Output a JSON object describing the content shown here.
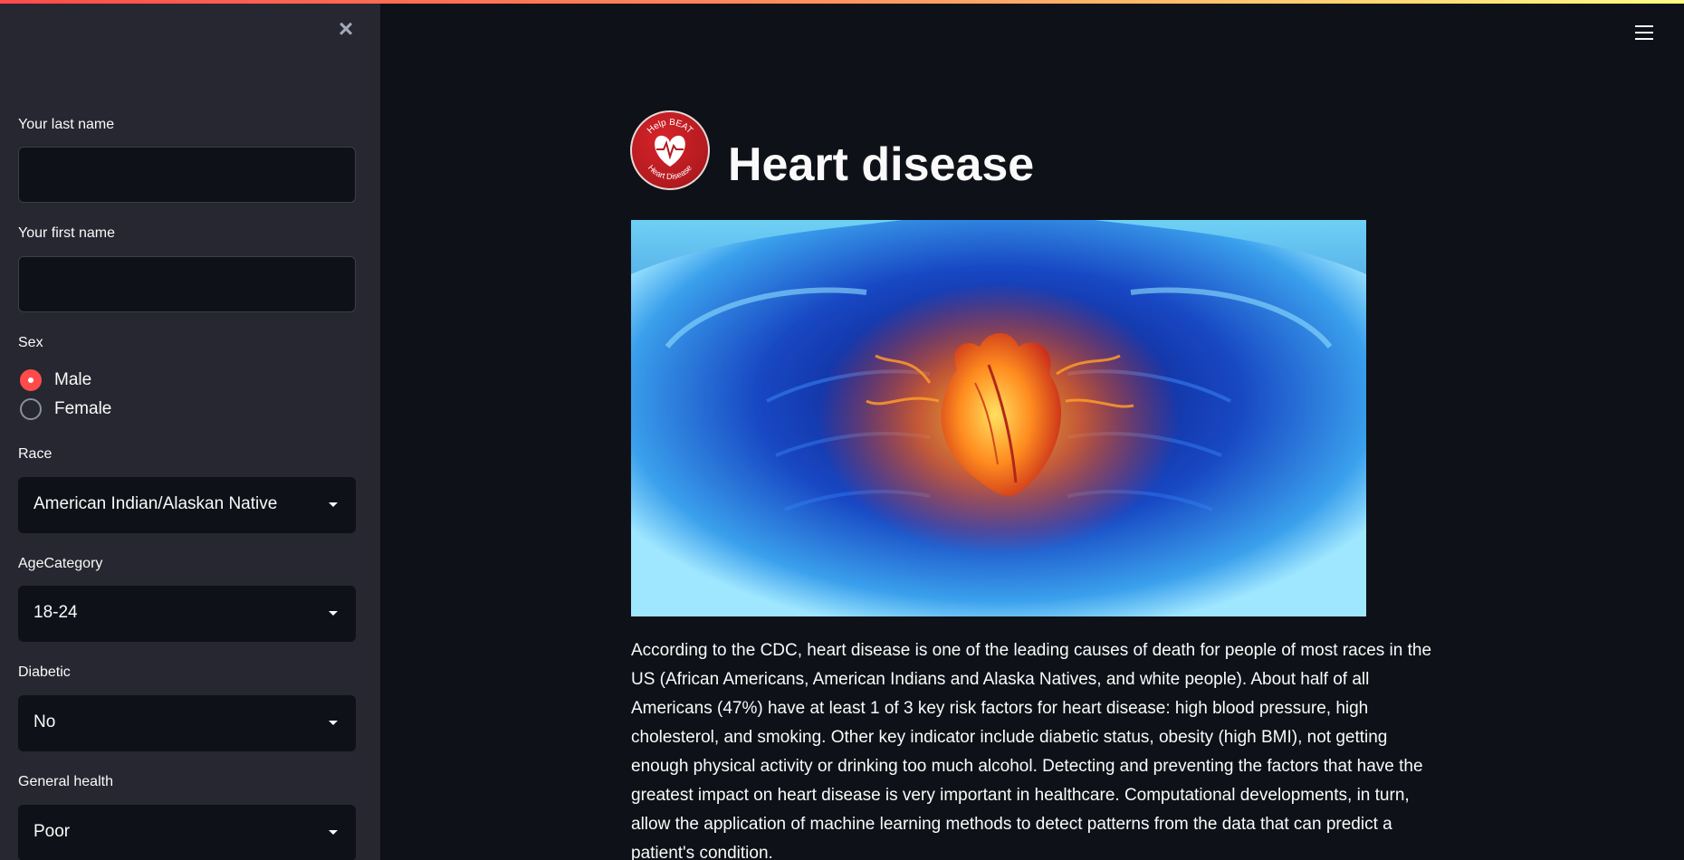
{
  "sidebar": {
    "close_label": "×",
    "last_name": {
      "label": "Your last name",
      "value": ""
    },
    "first_name": {
      "label": "Your first name",
      "value": ""
    },
    "sex": {
      "label": "Sex",
      "options": [
        "Male",
        "Female"
      ],
      "selected": "Male"
    },
    "race": {
      "label": "Race",
      "value": "American Indian/Alaskan Native"
    },
    "age_category": {
      "label": "AgeCategory",
      "value": "18-24"
    },
    "diabetic": {
      "label": "Diabetic",
      "value": "No"
    },
    "general_health": {
      "label": "General health",
      "value": "Poor"
    }
  },
  "header": {
    "logo_text_top": "Help BEAT",
    "logo_text_bottom": "Heart Disease",
    "title": "Heart disease"
  },
  "main": {
    "description": "According to the CDC, heart disease is one of the leading causes of death for people of most races in the US (African Americans, American Indians and Alaska Natives, and white people). About half of all Americans (47%) have at least 1 of 3 key risk factors for heart disease: high blood pressure, high cholesterol, and smoking. Other key indicator include diabetic status, obesity (high BMI), not getting enough physical activity or drinking too much alcohol. Detecting and preventing the factors that have the greatest impact on heart disease is very important in healthcare. Computational developments, in turn, allow the application of machine learning methods to detect patterns from the data that can predict a patient's condition."
  },
  "colors": {
    "accent": "#ff4b4b",
    "sidebar_bg": "#262730",
    "main_bg": "#0e1117"
  }
}
